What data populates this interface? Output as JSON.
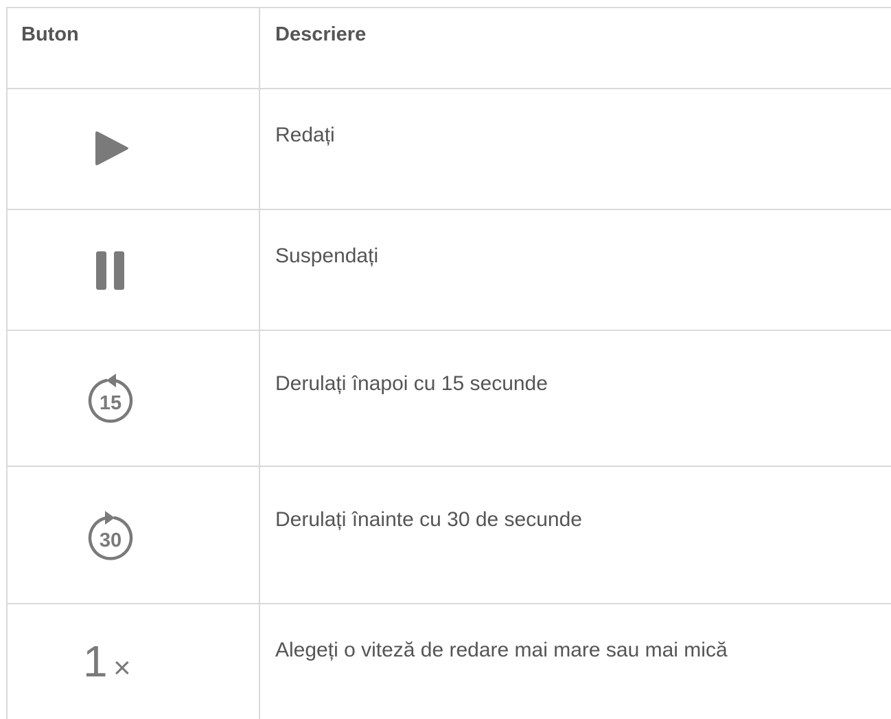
{
  "table": {
    "headers": {
      "button": "Buton",
      "description": "Descriere"
    },
    "rows": [
      {
        "icon": "play-icon",
        "description": "Redați"
      },
      {
        "icon": "pause-icon",
        "description": "Suspendați"
      },
      {
        "icon": "skip-back-15-icon",
        "icon_label": "15",
        "description": "Derulați înapoi cu 15 secunde"
      },
      {
        "icon": "skip-forward-30-icon",
        "icon_label": "30",
        "description": "Derulați înainte cu 30 de secunde"
      },
      {
        "icon": "playback-speed-icon",
        "icon_label": "1",
        "icon_suffix": "×",
        "description": "Alegeți o viteză de redare mai mare sau mai mică"
      }
    ]
  },
  "colors": {
    "border": "#d9d9d9",
    "text": "#555555",
    "icon": "#7a7a7a"
  }
}
